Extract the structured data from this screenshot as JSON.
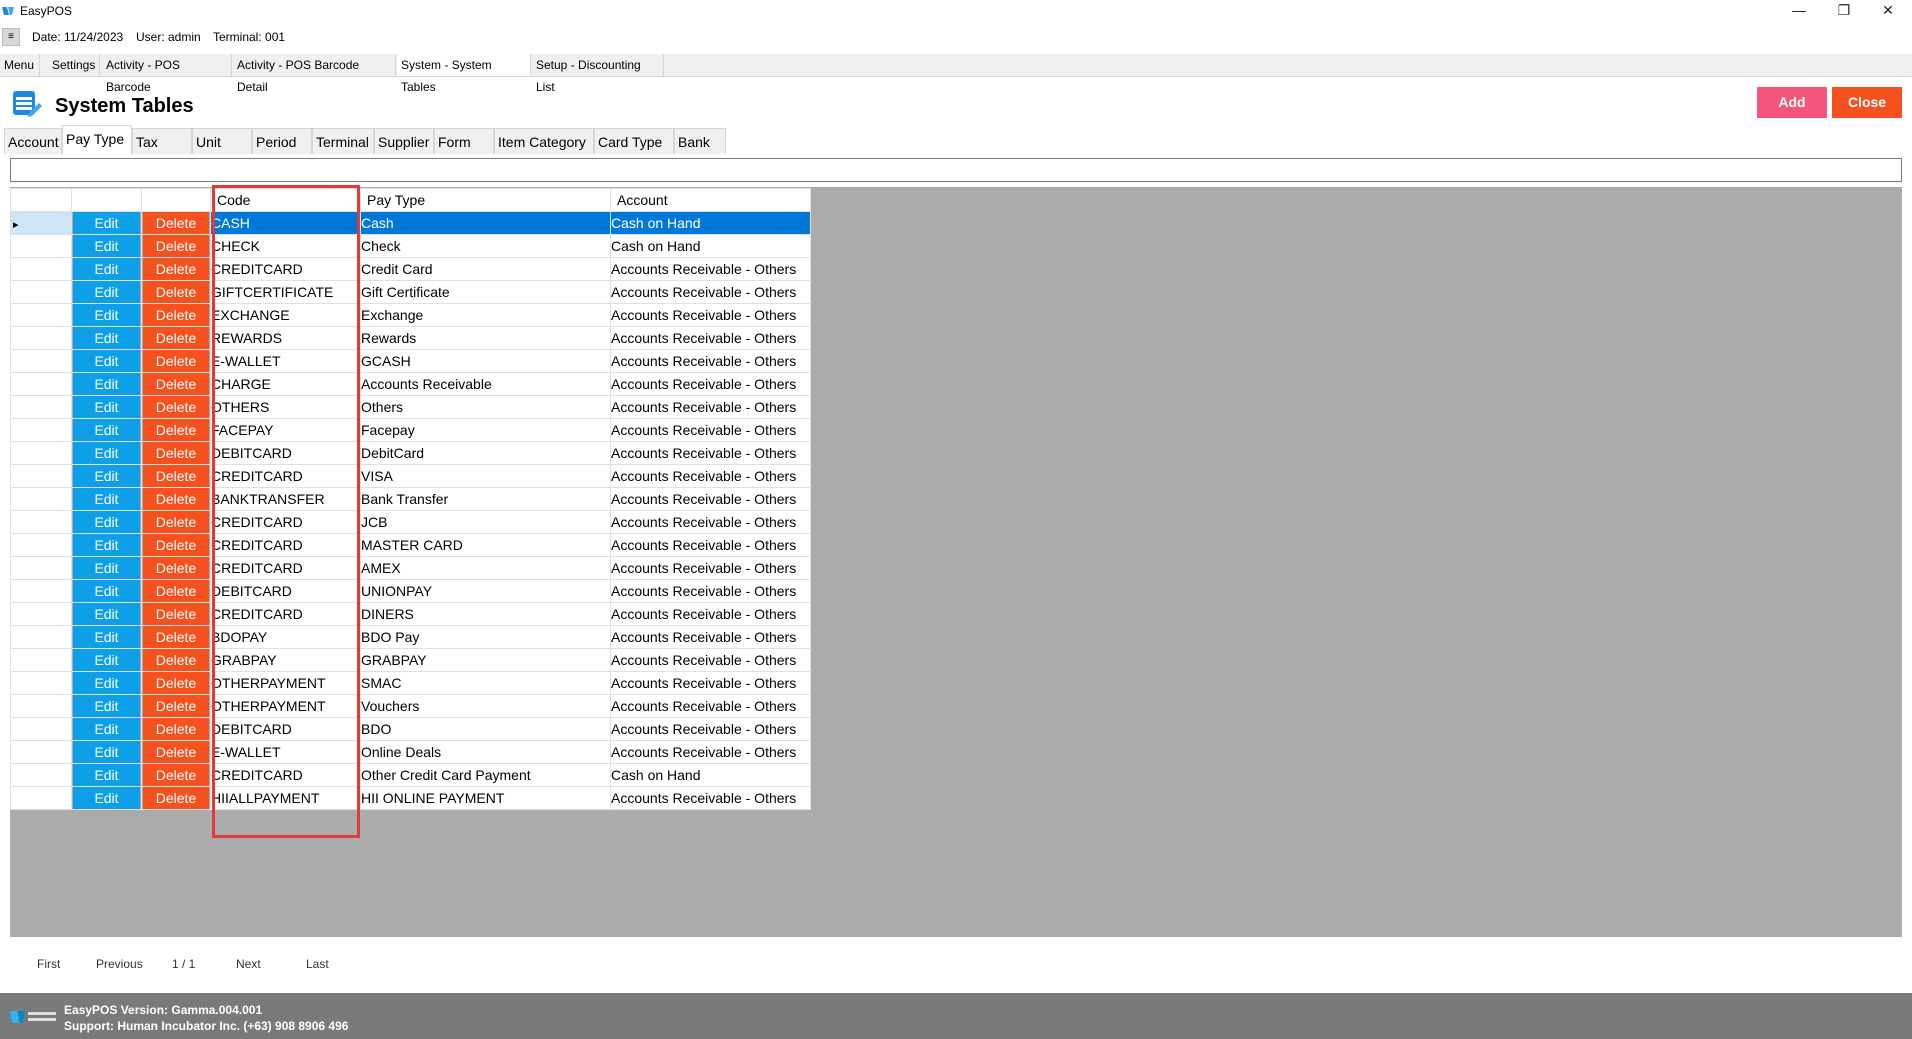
{
  "window": {
    "title": "EasyPOS",
    "controls": [
      "—",
      "❐",
      "✕"
    ]
  },
  "info": {
    "menu_toggle": "≡",
    "date": "Date: 11/24/2023",
    "user": "User: admin",
    "terminal": "Terminal: 001"
  },
  "tabs": [
    "Menu",
    "Settings",
    "Activity - POS Barcode",
    "Activity - POS Barcode Detail",
    "System - System Tables",
    "Setup - Discounting List"
  ],
  "page": {
    "title": "System Tables",
    "add_label": "Add",
    "close_label": "Close"
  },
  "subtabs": [
    "Account",
    "Pay Type",
    "Tax",
    "Unit",
    "Period",
    "Terminal",
    "Supplier",
    "Form",
    "Item Category",
    "Card Type",
    "Bank"
  ],
  "grid": {
    "headers": {
      "code": "Code",
      "pay_type": "Pay Type",
      "account": "Account"
    },
    "edit_label": "Edit",
    "delete_label": "Delete",
    "rows": [
      [
        "CASH",
        "Cash",
        "Cash on Hand"
      ],
      [
        "CHECK",
        "Check",
        "Cash on Hand"
      ],
      [
        "CREDITCARD",
        "Credit Card",
        "Accounts Receivable - Others"
      ],
      [
        "GIFTCERTIFICATE",
        "Gift Certificate",
        "Accounts Receivable - Others"
      ],
      [
        "EXCHANGE",
        "Exchange",
        "Accounts Receivable - Others"
      ],
      [
        "REWARDS",
        "Rewards",
        "Accounts Receivable - Others"
      ],
      [
        "E-WALLET",
        "GCASH",
        "Accounts Receivable - Others"
      ],
      [
        "CHARGE",
        "Accounts Receivable",
        "Accounts Receivable - Others"
      ],
      [
        "OTHERS",
        "Others",
        "Accounts Receivable - Others"
      ],
      [
        "FACEPAY",
        "Facepay",
        "Accounts Receivable - Others"
      ],
      [
        "DEBITCARD",
        "DebitCard",
        "Accounts Receivable - Others"
      ],
      [
        "CREDITCARD",
        "VISA",
        "Accounts Receivable - Others"
      ],
      [
        "BANKTRANSFER",
        "Bank Transfer",
        "Accounts Receivable - Others"
      ],
      [
        "CREDITCARD",
        "JCB",
        "Accounts Receivable - Others"
      ],
      [
        "CREDITCARD",
        "MASTER CARD",
        "Accounts Receivable - Others"
      ],
      [
        "CREDITCARD",
        "AMEX",
        "Accounts Receivable - Others"
      ],
      [
        "DEBITCARD",
        "UNIONPAY",
        "Accounts Receivable - Others"
      ],
      [
        "CREDITCARD",
        "DINERS",
        "Accounts Receivable - Others"
      ],
      [
        "BDOPAY",
        "BDO Pay",
        "Accounts Receivable - Others"
      ],
      [
        "GRABPAY",
        "GRABPAY",
        "Accounts Receivable - Others"
      ],
      [
        "OTHERPAYMENT",
        "SMAC",
        "Accounts Receivable - Others"
      ],
      [
        "OTHERPAYMENT",
        "Vouchers",
        "Accounts Receivable - Others"
      ],
      [
        "DEBITCARD",
        "BDO",
        "Accounts Receivable - Others"
      ],
      [
        "E-WALLET",
        "Online Deals",
        "Accounts Receivable - Others"
      ],
      [
        "CREDITCARD",
        "Other Credit Card Payment",
        "Cash on Hand"
      ],
      [
        "HIIALLPAYMENT",
        "HII ONLINE PAYMENT",
        "Accounts Receivable - Others"
      ]
    ],
    "selected_row_marker": "▸"
  },
  "pager": {
    "first": "First",
    "previous": "Previous",
    "page": "1 / 1",
    "next": "Next",
    "last": "Last"
  },
  "footer": {
    "version": "EasyPOS Version: Gamma.004.001",
    "support": "Support: Human Incubator Inc. (+63) 908 8906 496"
  },
  "colors": {
    "edit": "#0d9fe8",
    "delete": "#f4511e",
    "add": "#f4557a",
    "selection": "#0078d7",
    "highlight_box": "#e03b3b"
  }
}
